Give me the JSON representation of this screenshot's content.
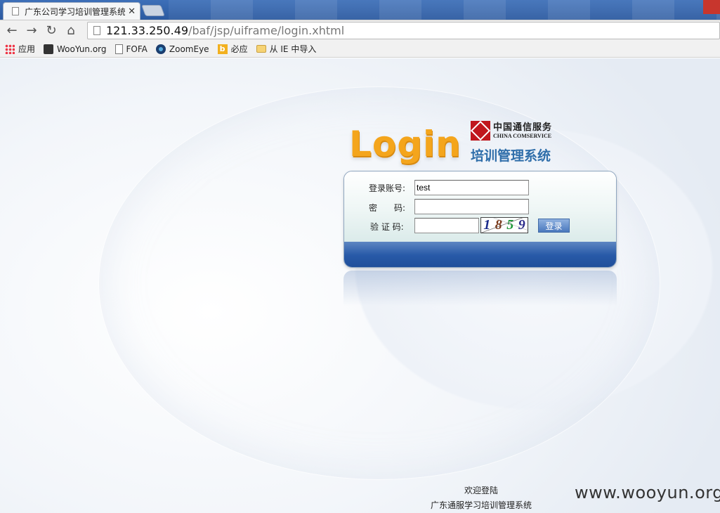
{
  "browser": {
    "tab_title": "广东公司学习培训管理系统",
    "tab_close": "✕",
    "url_host": "121.33.250.49",
    "url_path": "/baf/jsp/uiframe/login.xhtml",
    "nav": {
      "back": "←",
      "forward": "→",
      "reload": "↻",
      "home": "⌂"
    }
  },
  "bookmarks": [
    {
      "label": "应用",
      "icon": "apps-icon"
    },
    {
      "label": "WooYun.org",
      "icon": "wooyun-icon"
    },
    {
      "label": "FOFA",
      "icon": "page-icon"
    },
    {
      "label": "ZoomEye",
      "icon": "zoomeye-icon"
    },
    {
      "label": "必应",
      "icon": "bing-icon"
    },
    {
      "label": "从 IE 中导入",
      "icon": "folder-icon"
    }
  ],
  "logo": {
    "text": "Login",
    "brand_cn": "中国通信服务",
    "brand_en": "CHINA COMSERVICE",
    "system_title": "培训管理系统"
  },
  "form": {
    "account_label": "登录账号:",
    "account_value": "test",
    "password_label": "密　　码:",
    "password_value": "",
    "captcha_label": "验 证 码:",
    "captcha_value": "",
    "captcha_digits": [
      "1",
      "8",
      "5",
      "9"
    ],
    "submit_label": "登录"
  },
  "footer": {
    "line1": "欢迎登陆",
    "line2": "广东通服学习培训管理系统"
  },
  "watermark": "www.wooyun.org",
  "colors": {
    "tab_bar": "#2c5aa0",
    "logo_orange": "#f4a51c",
    "title_blue": "#2f6eaa",
    "panel_blue": "#285aa8",
    "brand_red": "#c0171d"
  }
}
